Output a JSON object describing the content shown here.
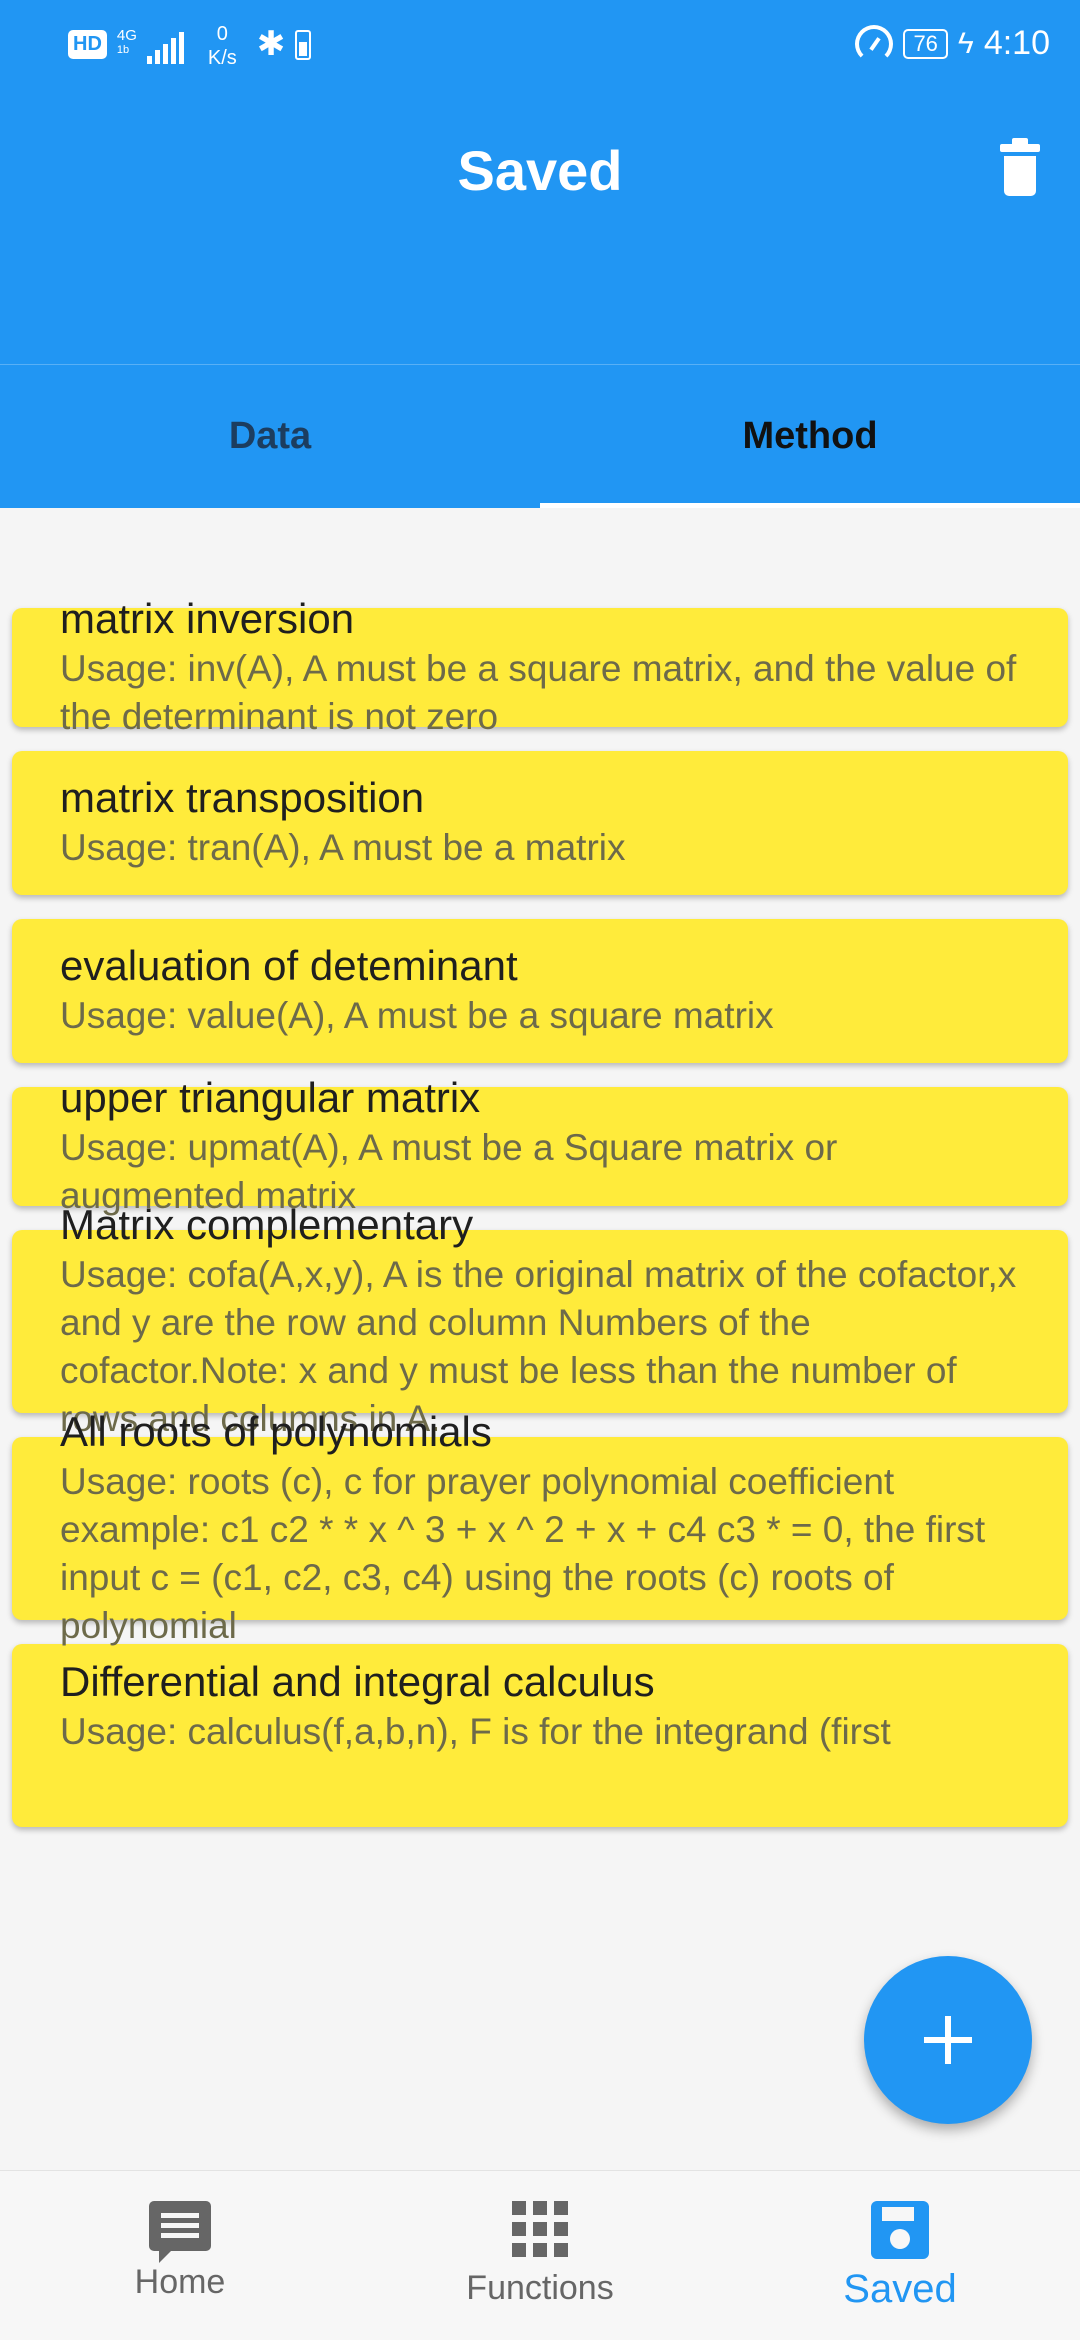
{
  "status_bar": {
    "hd": "HD",
    "network": "4G",
    "network_sub": "1b",
    "speed_value": "0",
    "speed_unit": "K/s",
    "battery": "76",
    "time": "4:10"
  },
  "app_bar": {
    "title": "Saved",
    "delete_icon": "trash-icon"
  },
  "tabs": [
    {
      "label": "Data",
      "selected": false
    },
    {
      "label": "Method",
      "selected": true
    }
  ],
  "items": [
    {
      "title": "matrix inversion",
      "desc": "Usage: inv(A), A must be a square matrix, and the value of the determinant is not zero"
    },
    {
      "title": "matrix transposition",
      "desc": "Usage: tran(A), A must be a matrix"
    },
    {
      "title": "evaluation of deteminant",
      "desc": "Usage: value(A), A must be a square matrix"
    },
    {
      "title": "upper triangular matrix",
      "desc": "Usage: upmat(A), A must be a Square matrix or augmented matrix"
    },
    {
      "title": "Matrix complementary",
      "desc": "Usage: cofa(A,x,y), A is the original matrix of the cofactor,x and y are the row and column Numbers of the cofactor.Note: x and y must be less than the number of rows and columns in A."
    },
    {
      "title": "All roots of polynomials",
      "desc": "Usage: roots (c), c for prayer polynomial coefficient example: c1 c2 * * x ^ 3 + x ^ 2 + x + c4 c3 * = 0, the first input c = (c1, c2, c3, c4) using the roots (c) roots of polynomial"
    },
    {
      "title": "Differential and integral calculus",
      "desc": "Usage: calculus(f,a,b,n), F is for the integrand (first"
    }
  ],
  "fab": {
    "icon": "plus-icon"
  },
  "bottom_nav": [
    {
      "label": "Home",
      "icon": "message-icon",
      "active": false
    },
    {
      "label": "Functions",
      "icon": "grid-icon",
      "active": false
    },
    {
      "label": "Saved",
      "icon": "save-icon",
      "active": true
    }
  ],
  "colors": {
    "primary": "#2196F3",
    "card": "#FFEB3B",
    "background": "#F5F5F5"
  }
}
